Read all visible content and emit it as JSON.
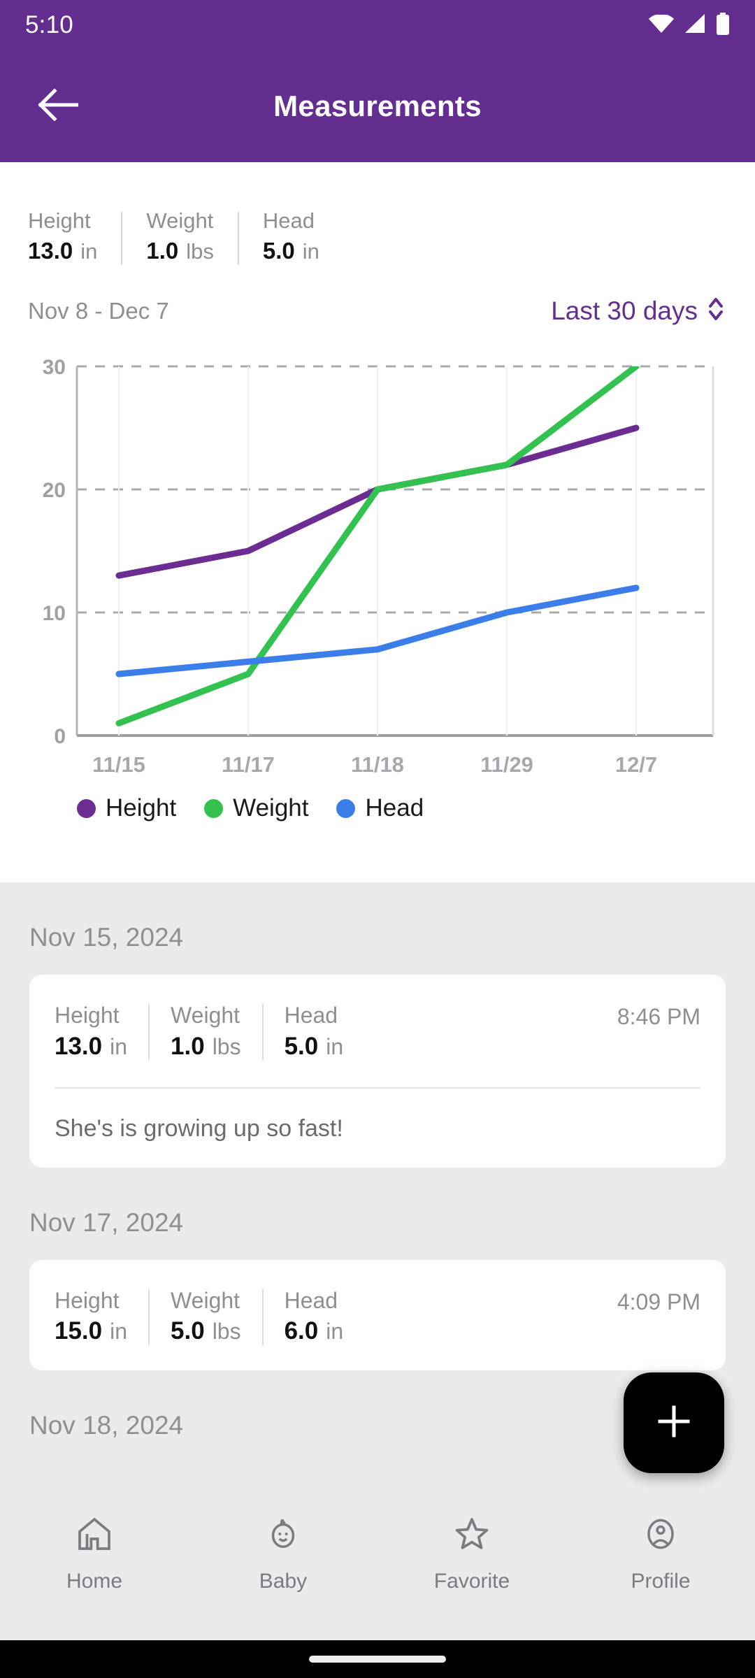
{
  "status_bar": {
    "time": "5:10",
    "icons": [
      "wifi-icon",
      "cellular-signal-icon",
      "battery-icon"
    ]
  },
  "app_bar": {
    "title": "Measurements",
    "back_icon": "back-arrow-icon"
  },
  "summary": {
    "metrics": [
      {
        "label": "Height",
        "value": "13.0",
        "unit": "in"
      },
      {
        "label": "Weight",
        "value": "1.0",
        "unit": "lbs"
      },
      {
        "label": "Head",
        "value": "5.0",
        "unit": "in"
      }
    ]
  },
  "range": {
    "date_range": "Nov 8 - Dec 7",
    "selected": "Last 30 days",
    "stepper_icon": "up-down-chevron-icon"
  },
  "chart_data": {
    "type": "line",
    "title": "",
    "xlabel": "",
    "ylabel": "",
    "x": [
      "11/15",
      "11/17",
      "11/18",
      "11/29",
      "12/7"
    ],
    "yticks": [
      0,
      10,
      20,
      30
    ],
    "ylim": [
      0,
      30
    ],
    "grid": true,
    "legend_position": "bottom-left",
    "series": [
      {
        "name": "Height",
        "color": "#6B2D91",
        "values": [
          13,
          15,
          20,
          22,
          25
        ]
      },
      {
        "name": "Weight",
        "color": "#33C24F",
        "values": [
          1,
          5,
          20,
          22,
          30
        ]
      },
      {
        "name": "Head",
        "color": "#3B7EEA",
        "values": [
          5,
          6,
          7,
          10,
          12
        ]
      }
    ]
  },
  "entries": [
    {
      "date": "Nov 15, 2024",
      "time": "8:46 PM",
      "metrics": [
        {
          "label": "Height",
          "value": "13.0",
          "unit": "in"
        },
        {
          "label": "Weight",
          "value": "1.0",
          "unit": "lbs"
        },
        {
          "label": "Head",
          "value": "5.0",
          "unit": "in"
        }
      ],
      "note": "She's is growing up so fast!"
    },
    {
      "date": "Nov 17, 2024",
      "time": "4:09 PM",
      "metrics": [
        {
          "label": "Height",
          "value": "15.0",
          "unit": "in"
        },
        {
          "label": "Weight",
          "value": "5.0",
          "unit": "lbs"
        },
        {
          "label": "Head",
          "value": "6.0",
          "unit": "in"
        }
      ],
      "note": ""
    },
    {
      "date": "Nov 18, 2024",
      "time": "",
      "metrics": [],
      "note": ""
    }
  ],
  "fab": {
    "icon": "plus-icon",
    "color": "#000000"
  },
  "bottom_nav": {
    "items": [
      {
        "label": "Home",
        "icon": "home-icon"
      },
      {
        "label": "Baby",
        "icon": "baby-face-icon"
      },
      {
        "label": "Favorite",
        "icon": "star-icon"
      },
      {
        "label": "Profile",
        "icon": "account-circle-icon"
      }
    ]
  },
  "theme": {
    "primary": "#632E8F",
    "background": "#E9EAEC",
    "card": "#FFFFFF",
    "muted_text": "#8E8E93"
  }
}
